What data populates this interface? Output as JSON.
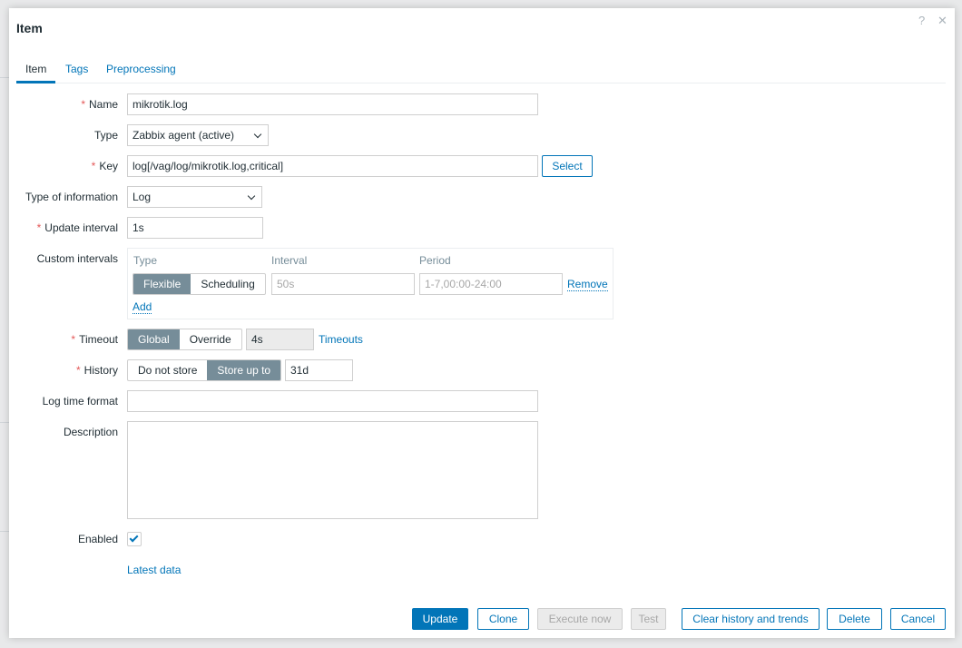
{
  "dialog": {
    "title": "Item",
    "help": "?",
    "close": "✕"
  },
  "tabs": [
    "Item",
    "Tags",
    "Preprocessing"
  ],
  "form": {
    "name": {
      "label": "Name",
      "value": "mikrotik.log"
    },
    "type": {
      "label": "Type",
      "value": "Zabbix agent (active)"
    },
    "key": {
      "label": "Key",
      "value": "log[/vag/log/mikrotik.log,critical]",
      "select": "Select"
    },
    "info": {
      "label": "Type of information",
      "value": "Log"
    },
    "interval": {
      "label": "Update interval",
      "value": "1s"
    },
    "custom": {
      "label": "Custom intervals",
      "col_type": "Type",
      "col_interval": "Interval",
      "col_period": "Period",
      "opt_flex": "Flexible",
      "opt_sched": "Scheduling",
      "interval_ph": "50s",
      "period_ph": "1-7,00:00-24:00",
      "remove": "Remove",
      "add": "Add"
    },
    "timeout": {
      "label": "Timeout",
      "opt_global": "Global",
      "opt_override": "Override",
      "value": "4s",
      "link": "Timeouts"
    },
    "history": {
      "label": "History",
      "opt_none": "Do not store",
      "opt_store": "Store up to",
      "value": "31d"
    },
    "logtime": {
      "label": "Log time format",
      "value": ""
    },
    "description": {
      "label": "Description",
      "value": ""
    },
    "enabled": {
      "label": "Enabled",
      "checked": true
    },
    "latest": "Latest data"
  },
  "footer": {
    "update": "Update",
    "clone": "Clone",
    "execute": "Execute now",
    "test": "Test",
    "clear": "Clear history and trends",
    "delete": "Delete",
    "cancel": "Cancel"
  }
}
